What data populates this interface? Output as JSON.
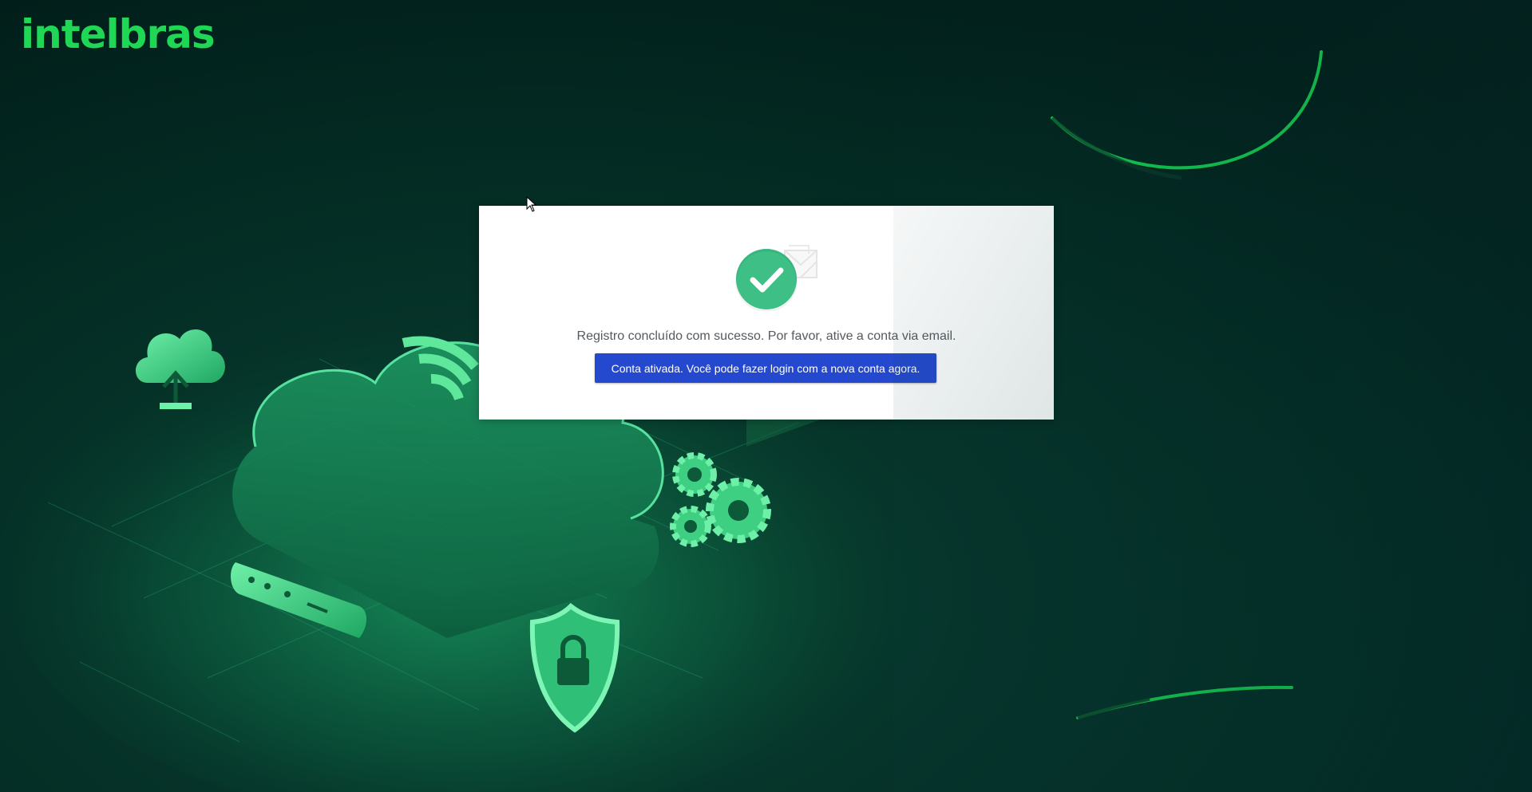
{
  "brand": {
    "logo_text": "intelbras",
    "accent_color": "#1fd655"
  },
  "modal": {
    "message": "Registro concluído com sucesso. Por favor, ative a conta via email.",
    "activation_button_label": "Conta ativada. Você pode fazer login com a nova conta agora.",
    "button_color": "#2449cf",
    "icon": "success-check-envelope-icon"
  },
  "background": {
    "illustration": "cloud-network-illustration",
    "icons": [
      "cloud-upload-icon",
      "wifi-icon",
      "gears-icon",
      "router-icon",
      "shield-lock-icon"
    ]
  }
}
